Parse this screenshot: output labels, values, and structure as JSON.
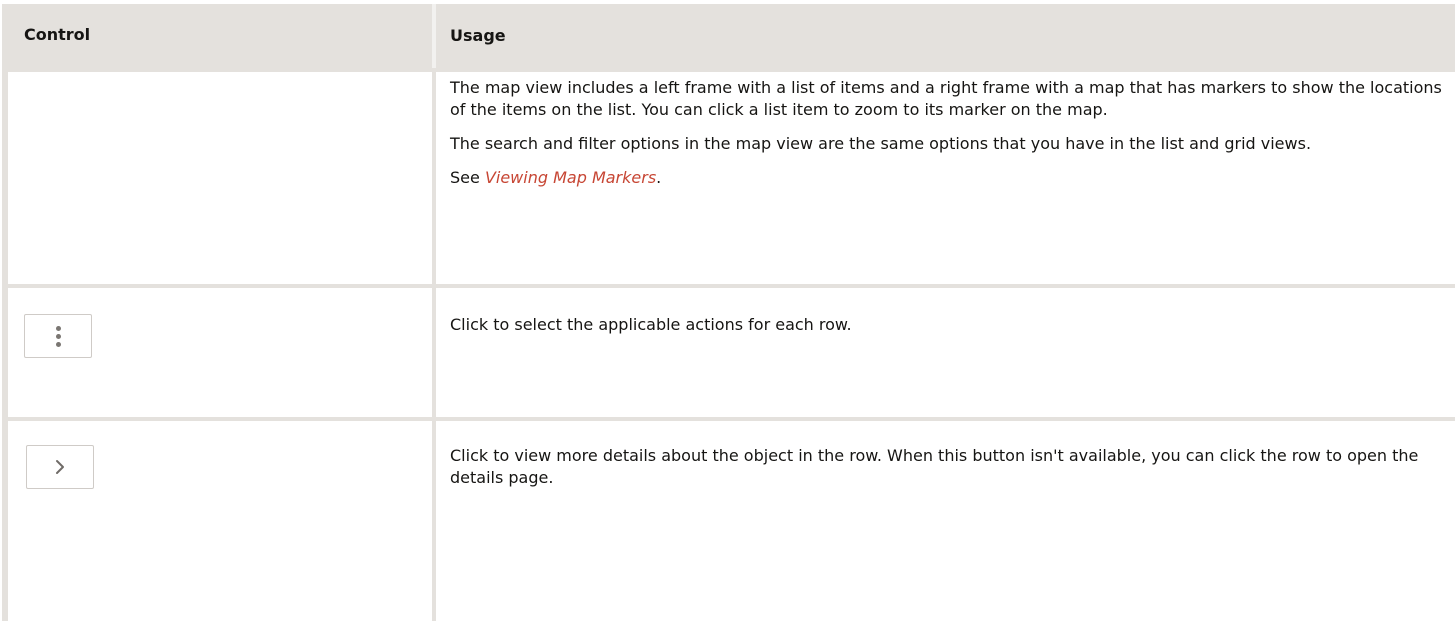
{
  "table": {
    "headers": {
      "control": "Control",
      "usage": "Usage"
    },
    "rows": [
      {
        "control_icon": "none",
        "usage": {
          "p1": "The map view includes a left frame with a list of items and a right frame with a map that has markers to show the locations of the items on the list. You can click a list item to zoom to its marker on the map.",
          "p2": "The search and filter options in the map view are the same options that you have in the list and grid views.",
          "p3_prefix": "See ",
          "p3_link": "Viewing Map Markers",
          "p3_suffix": "."
        }
      },
      {
        "control_icon": "more-actions-icon",
        "usage": {
          "p1": "Click to select the applicable actions for each row."
        }
      },
      {
        "control_icon": "chevron-right-icon",
        "usage": {
          "p1": "Click to view more details about the object in the row. When this button isn't available, you can click the row to open the details page."
        }
      }
    ]
  },
  "colors": {
    "header_bg": "#e4e1dd",
    "border": "#e4e1dd",
    "link": "#c74634",
    "text": "#161513"
  }
}
